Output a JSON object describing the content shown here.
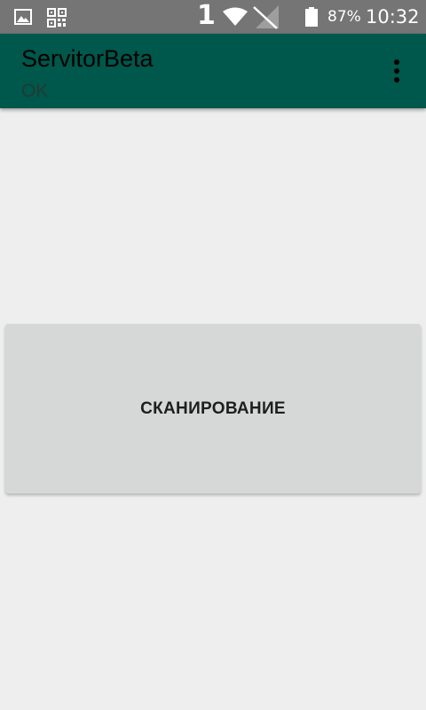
{
  "status_bar": {
    "icons": [
      "gallery-icon",
      "qr-code-icon",
      "sim-1-icon",
      "wifi-icon",
      "no-signal-icon",
      "battery-icon"
    ],
    "sim_label": "1",
    "battery_percent": "87%",
    "time": "10:32"
  },
  "app_bar": {
    "title": "ServitorBeta",
    "subtitle": "OK",
    "overflow_icon": "more-vert-icon",
    "color": "#00574b"
  },
  "main": {
    "scan_button_label": "СКАНИРОВАНИЕ"
  }
}
